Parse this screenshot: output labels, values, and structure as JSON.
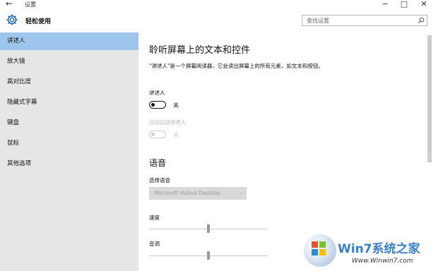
{
  "window": {
    "title": "设置",
    "back_icon": "back-arrow-icon",
    "minimize": "−",
    "maximize": "□",
    "close": "✕"
  },
  "header": {
    "app_title": "轻松使用",
    "search_placeholder": "查找设置"
  },
  "sidebar": {
    "items": [
      {
        "label": "讲述人",
        "active": true
      },
      {
        "label": "放大镜"
      },
      {
        "label": "高对比度"
      },
      {
        "label": "隐藏式字幕"
      },
      {
        "label": "键盘"
      },
      {
        "label": "鼠标"
      },
      {
        "label": "其他选项"
      }
    ]
  },
  "main": {
    "heading": "聆听屏幕上的文本和控件",
    "description": "\"讲述人\"是一个屏幕阅读器，它会读出屏幕上的所有元素，如文本和按钮。",
    "narrator": {
      "label": "讲述人",
      "state": "关",
      "on": false
    },
    "auto_start": {
      "label": "自动启动讲述人",
      "state": "关",
      "on": false,
      "disabled": true
    },
    "voice_heading": "语音",
    "choose_voice": {
      "label": "选择语音",
      "value": "Microsoft Huihui Desktop"
    },
    "speed": {
      "label": "速度",
      "level": 0.5
    },
    "pitch": {
      "label": "音调",
      "level": 0.5
    }
  },
  "watermark": {
    "brand": "Win7系统之家",
    "url": "Www.Winwin7.com"
  }
}
